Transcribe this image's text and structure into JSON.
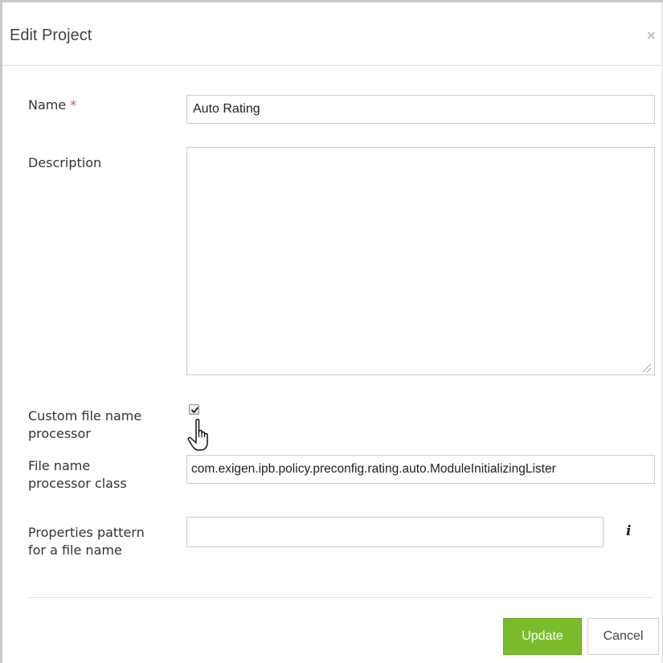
{
  "dialog": {
    "title": "Edit Project",
    "close_symbol": "×"
  },
  "form": {
    "name": {
      "label": "Name",
      "required_marker": "*",
      "value": "Auto Rating"
    },
    "description": {
      "label": "Description",
      "value": ""
    },
    "custom_processor": {
      "label_line1": "Custom file name",
      "label_line2": "processor",
      "checked": true
    },
    "processor_class": {
      "label_line1": "File name",
      "label_line2": "processor class",
      "value": "com.exigen.ipb.policy.preconfig.rating.auto.ModuleInitializingLister"
    },
    "properties_pattern": {
      "label_line1": "Properties pattern",
      "label_line2": "for a file name",
      "value": "",
      "info_symbol": "i"
    }
  },
  "footer": {
    "update_label": "Update",
    "cancel_label": "Cancel"
  },
  "colors": {
    "accent": "#7abc2b",
    "required": "#d9534f"
  },
  "icons": {
    "close": "close-icon",
    "info": "info-icon",
    "cursor": "hand-pointer-cursor"
  }
}
